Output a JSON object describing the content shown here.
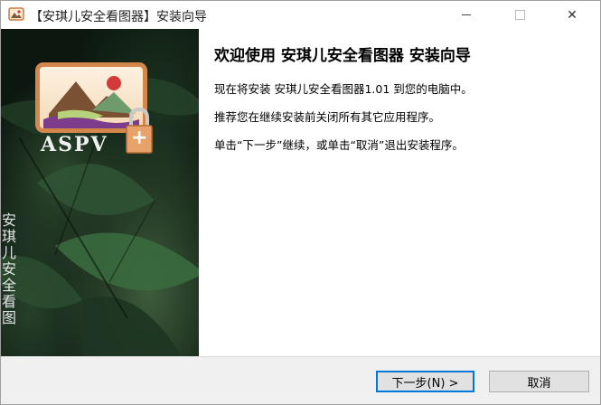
{
  "window": {
    "title": "【安琪儿安全看图器】安装向导",
    "controls": {
      "minimize": "minimize-icon",
      "maximize": "maximize-icon",
      "close": "close-icon",
      "close_glyph": "✕"
    }
  },
  "side_panel": {
    "logo_text": "ASPV",
    "lock_glyph": "+",
    "vertical_text": "安琪儿安全看图"
  },
  "content": {
    "heading": "欢迎使用 安琪儿安全看图器 安装向导",
    "line1": "现在将安装 安琪儿安全看图器1.01 到您的电脑中。",
    "line2": "推荐您在继续安装前关闭所有其它应用程序。",
    "line3": "单击“下一步”继续，或单击“取消”退出安装程序。"
  },
  "buttons": {
    "next": "下一步(N) >",
    "cancel": "取消"
  },
  "colors": {
    "accent": "#0078d7",
    "logo_frame": "#d4874a"
  }
}
